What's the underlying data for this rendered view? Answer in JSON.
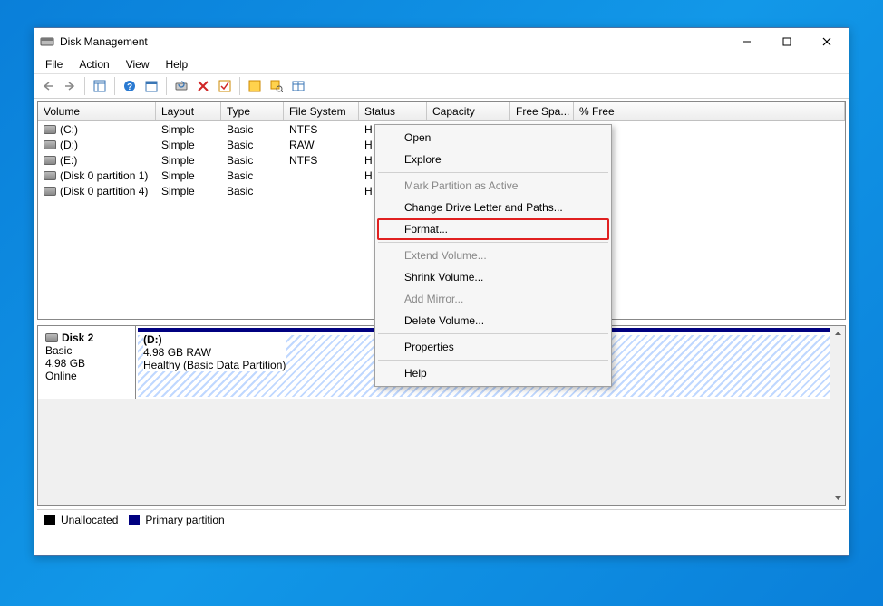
{
  "window": {
    "title": "Disk Management"
  },
  "menu": {
    "file": "File",
    "action": "Action",
    "view": "View",
    "help": "Help"
  },
  "headers": {
    "volume": "Volume",
    "layout": "Layout",
    "type": "Type",
    "fs": "File System",
    "status": "Status",
    "capacity": "Capacity",
    "free": "Free Spa...",
    "pct": "% Free"
  },
  "rows": [
    {
      "volume": "(C:)",
      "layout": "Simple",
      "type": "Basic",
      "fs": "NTFS",
      "status": "H",
      "pct": "%"
    },
    {
      "volume": "(D:)",
      "layout": "Simple",
      "type": "Basic",
      "fs": "RAW",
      "status": "H",
      "pct": "%"
    },
    {
      "volume": "(E:)",
      "layout": "Simple",
      "type": "Basic",
      "fs": "NTFS",
      "status": "H",
      "pct": "%"
    },
    {
      "volume": "(Disk 0 partition 1)",
      "layout": "Simple",
      "type": "Basic",
      "fs": "",
      "status": "H",
      "pct": "%"
    },
    {
      "volume": "(Disk 0 partition 4)",
      "layout": "Simple",
      "type": "Basic",
      "fs": "",
      "status": "H",
      "pct": "%"
    }
  ],
  "disk": {
    "name": "Disk 2",
    "type": "Basic",
    "size": "4.98 GB",
    "status": "Online",
    "part": {
      "letter": "(D:)",
      "info": "4.98 GB RAW",
      "health": "Healthy (Basic Data Partition)"
    }
  },
  "legend": {
    "unalloc": "Unallocated",
    "primary": "Primary partition"
  },
  "ctx": {
    "open": "Open",
    "explore": "Explore",
    "mark": "Mark Partition as Active",
    "change": "Change Drive Letter and Paths...",
    "format": "Format...",
    "extend": "Extend Volume...",
    "shrink": "Shrink Volume...",
    "mirror": "Add Mirror...",
    "delete": "Delete Volume...",
    "properties": "Properties",
    "help": "Help"
  }
}
